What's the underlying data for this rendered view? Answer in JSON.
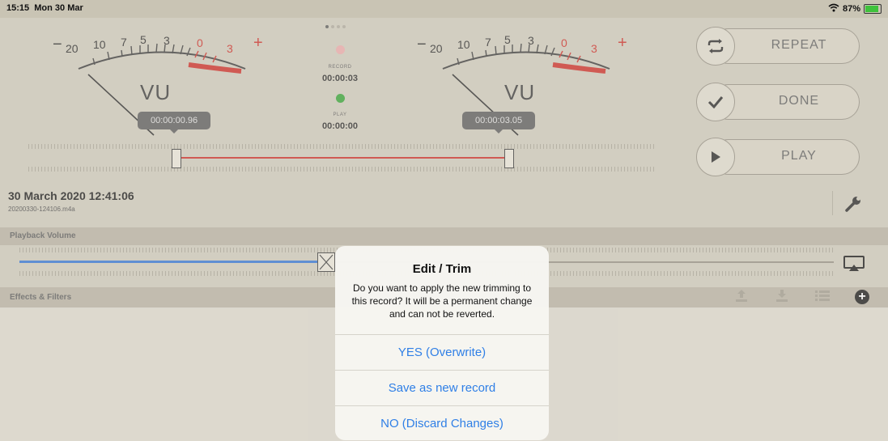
{
  "status_bar": {
    "time": "15:15",
    "date": "Mon 30 Mar",
    "battery": "87%"
  },
  "meters": [
    {
      "scale": [
        "−",
        "20",
        "10",
        "7",
        "5",
        "3",
        "0",
        "3",
        "+"
      ],
      "label": "VU",
      "bubble": "00:00:00.96"
    },
    {
      "scale": [
        "−",
        "20",
        "10",
        "7",
        "5",
        "3",
        "0",
        "3",
        "+"
      ],
      "label": "VU",
      "bubble": "00:00:03.05"
    }
  ],
  "center": {
    "record_label": "RECORD",
    "record_time": "00:00:03",
    "play_label": "PLAY",
    "play_time": "00:00:00"
  },
  "side_buttons": [
    {
      "label": "REPEAT",
      "icon": "repeat-icon"
    },
    {
      "label": "DONE",
      "icon": "checkmark-icon"
    },
    {
      "label": "PLAY",
      "icon": "play-icon"
    }
  ],
  "recording": {
    "title": "30 March 2020 12:41:06",
    "filename": "20200330-124106.m4a"
  },
  "playback": {
    "title": "Playback Volume",
    "volume": 0.38
  },
  "effects": {
    "title": "Effects & Filters"
  },
  "alert": {
    "title": "Edit / Trim",
    "message": "Do you want to apply the new trimming to this record? It will be a permanent change and can not be reverted.",
    "buttons": [
      "YES (Overwrite)",
      "Save as new record",
      "NO (Discard Changes)"
    ]
  },
  "colors": {
    "accent": "#2f7fe6",
    "record_led": "#e8a5a5",
    "play_led": "#2e9e2e",
    "meter_red": "#c8261f"
  }
}
